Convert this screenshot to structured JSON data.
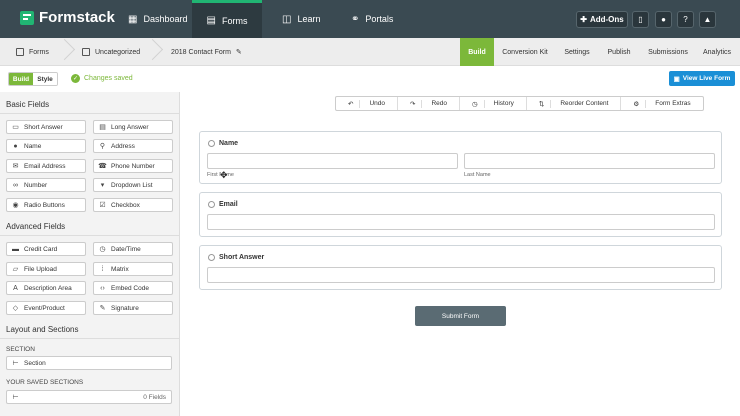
{
  "topnav": {
    "brand": "Formstack",
    "items": [
      {
        "label": "Dashboard",
        "icon": "dashboard-icon"
      },
      {
        "label": "Forms",
        "icon": "forms-icon",
        "active": true
      },
      {
        "label": "Learn",
        "icon": "book-icon"
      },
      {
        "label": "Portals",
        "icon": "portals-icon"
      }
    ],
    "addons_label": "Add-Ons",
    "icon_buttons": [
      "book-icon",
      "user-icon",
      "help-icon",
      "bell-icon"
    ]
  },
  "breadcrumb": {
    "items": [
      "Forms",
      "Uncategorized",
      "2018 Contact Form"
    ]
  },
  "subtabs": [
    "Build",
    "Conversion Kit",
    "Settings",
    "Publish",
    "Submissions",
    "Analytics"
  ],
  "toolbar": {
    "build_label": "Build",
    "style_label": "Style",
    "status": "Changes saved",
    "view_live": "View Live Form"
  },
  "sidebar": {
    "basic_title": "Basic Fields",
    "basic_fields": [
      {
        "label": "Short Answer",
        "icon": "text-line-icon"
      },
      {
        "label": "Long Answer",
        "icon": "text-area-icon"
      },
      {
        "label": "Name",
        "icon": "person-icon"
      },
      {
        "label": "Address",
        "icon": "pin-icon"
      },
      {
        "label": "Email Address",
        "icon": "mail-icon"
      },
      {
        "label": "Phone Number",
        "icon": "phone-icon"
      },
      {
        "label": "Number",
        "icon": "infinity-icon"
      },
      {
        "label": "Dropdown List",
        "icon": "dropdown-icon"
      },
      {
        "label": "Radio Buttons",
        "icon": "radio-icon"
      },
      {
        "label": "Checkbox",
        "icon": "checkbox-icon"
      }
    ],
    "advanced_title": "Advanced Fields",
    "advanced_fields": [
      {
        "label": "Credit Card",
        "icon": "card-icon"
      },
      {
        "label": "Date/Time",
        "icon": "clock-icon"
      },
      {
        "label": "File Upload",
        "icon": "upload-icon"
      },
      {
        "label": "Matrix",
        "icon": "grid-icon"
      },
      {
        "label": "Description Area",
        "icon": "font-icon"
      },
      {
        "label": "Embed Code",
        "icon": "code-icon"
      },
      {
        "label": "Event/Product",
        "icon": "tag-icon"
      },
      {
        "label": "Signature",
        "icon": "pen-icon"
      }
    ],
    "layout_title": "Layout and Sections",
    "section_label": "SECTION",
    "section_item": "Section",
    "saved_label": "YOUR SAVED SECTIONS",
    "saved_count": "0 Fields"
  },
  "edit_toolbar": {
    "undo": "Undo",
    "redo": "Redo",
    "history": "History",
    "reorder": "Reorder Content",
    "extras": "Form Extras"
  },
  "form": {
    "name_label": "Name",
    "first_name": "First Name",
    "last_name": "Last Name",
    "email_label": "Email",
    "short_answer_label": "Short Answer",
    "submit_label": "Submit Form"
  },
  "colors": {
    "nav_bg": "#3a4a52",
    "accent_green": "#7cb83a",
    "brand_green": "#21b573",
    "live_blue": "#1a8fd6"
  }
}
